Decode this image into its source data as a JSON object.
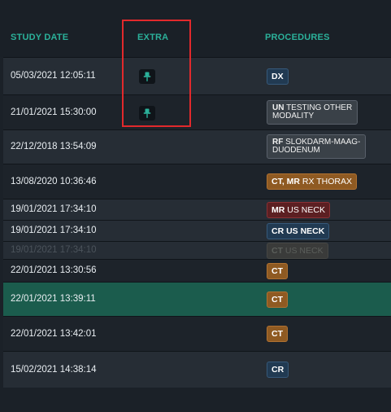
{
  "headers": {
    "study_date": "STUDY DATE",
    "extra": "EXTRA",
    "procedures": "PROCEDURES"
  },
  "colors": {
    "accent": "#2bb19a",
    "highlight": "#e2292c",
    "selected_row": "#1b5c4d"
  },
  "rows": [
    {
      "date": "05/03/2021 12:05:11",
      "pinned": true,
      "pin_icon": "pin-icon",
      "badge": {
        "modality": "DX",
        "text": "",
        "style": "blue"
      }
    },
    {
      "date": "21/01/2021 15:30:00",
      "pinned": true,
      "pin_icon": "pin-icon",
      "badge": {
        "modality": "UN",
        "text": "TESTING OTHER",
        "text2": "MODALITY",
        "style": "gray"
      }
    },
    {
      "date": "22/12/2018 13:54:09",
      "pinned": false,
      "badge": {
        "modality": "RF",
        "text": "SLOKDARM-MAAG-",
        "text2": "DUODENUM",
        "style": "gray"
      }
    },
    {
      "date": "13/08/2020 10:36:46",
      "pinned": false,
      "badge": {
        "modality": "CT, MR",
        "text": "RX THORAX",
        "style": "orange"
      }
    },
    {
      "date": "19/01/2021 17:34:10",
      "pinned": false,
      "badge": {
        "modality": "MR",
        "text": "US NECK",
        "style": "red"
      }
    },
    {
      "date": "19/01/2021 17:34:10",
      "pinned": false,
      "badge": {
        "modality": "CR",
        "text": "US NECK",
        "style": "blue"
      }
    },
    {
      "date": "19/01/2021 17:34:10",
      "pinned": false,
      "dimmed": true,
      "badge": {
        "modality": "CT",
        "text": "US NECK",
        "style": "faded"
      }
    },
    {
      "date": "22/01/2021 13:30:56",
      "pinned": false,
      "badge": {
        "modality": "CT",
        "text": "",
        "style": "orange"
      }
    },
    {
      "date": "22/01/2021 13:39:11",
      "pinned": false,
      "selected": true,
      "badge": {
        "modality": "CT",
        "text": "",
        "style": "orange"
      }
    },
    {
      "date": "22/01/2021 13:42:01",
      "pinned": false,
      "badge": {
        "modality": "CT",
        "text": "",
        "style": "orange"
      }
    },
    {
      "date": "15/02/2021 14:38:14",
      "pinned": false,
      "badge": {
        "modality": "CR",
        "text": "",
        "style": "blue"
      }
    }
  ]
}
